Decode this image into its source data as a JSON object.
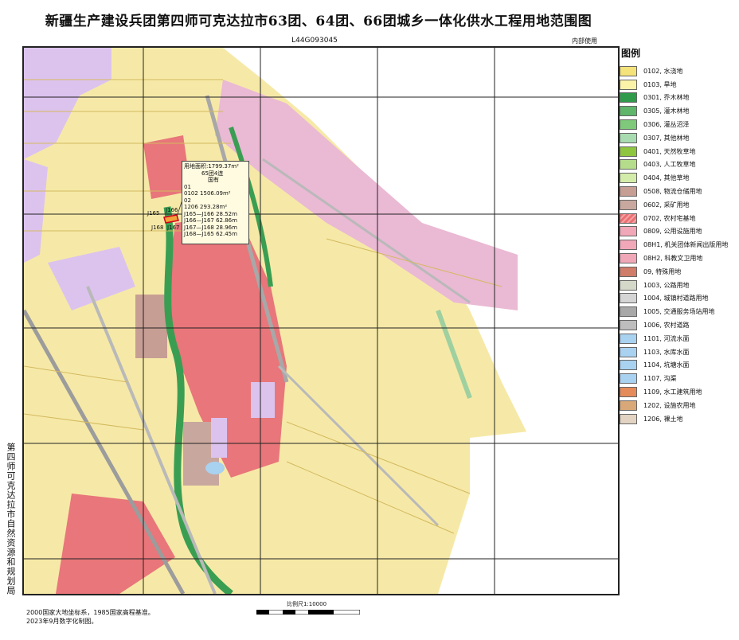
{
  "header": {
    "title": "新疆生产建设兵团第四师可克达拉市63团、64团、66团城乡一体化供水工程用地范围图",
    "sheet_number": "L44G093045",
    "secrecy": "内部使用"
  },
  "legend": {
    "title": "图例",
    "items": [
      {
        "label": "0102, 水浇地",
        "color": "#f4e27a"
      },
      {
        "label": "0103, 旱地",
        "color": "#fbf3a8"
      },
      {
        "label": "0301, 乔木林地",
        "color": "#2e9a4a"
      },
      {
        "label": "0305, 灌木林地",
        "color": "#5fb56a"
      },
      {
        "label": "0306, 灌丛沼泽",
        "color": "#7ec97a"
      },
      {
        "label": "0307, 其他林地",
        "color": "#a8dcb0"
      },
      {
        "label": "0401, 天然牧草地",
        "color": "#8fc63f"
      },
      {
        "label": "0403, 人工牧草地",
        "color": "#b5dc8a"
      },
      {
        "label": "0404, 其他草地",
        "color": "#d4ecaa"
      },
      {
        "label": "0508, 物流仓储用地",
        "color": "#c79e94"
      },
      {
        "label": "0602, 采矿用地",
        "color": "#c8a89e"
      },
      {
        "label": "0702, 农村宅基地",
        "color": "#ea6f72"
      },
      {
        "label": "0809, 公用设施用地",
        "color": "#f0a7b7"
      },
      {
        "label": "08H1, 机关团体新闻出版用地",
        "color": "#f0a7b7"
      },
      {
        "label": "08H2, 科教文卫用地",
        "color": "#f0a7b7"
      },
      {
        "label": "09, 特殊用地",
        "color": "#cf7c68"
      },
      {
        "label": "1003, 公路用地",
        "color": "#d4d8c8"
      },
      {
        "label": "1004, 城镇村道路用地",
        "color": "#d5d5d5"
      },
      {
        "label": "1005, 交通服务场站用地",
        "color": "#a8a8a8"
      },
      {
        "label": "1006, 农村道路",
        "color": "#bdbdbd"
      },
      {
        "label": "1101, 河流水面",
        "color": "#a9d1f0"
      },
      {
        "label": "1103, 水库水面",
        "color": "#a9d1f0"
      },
      {
        "label": "1104, 坑塘水面",
        "color": "#a9d1f0"
      },
      {
        "label": "1107, 沟渠",
        "color": "#a9d1f0"
      },
      {
        "label": "1109, 水工建筑用地",
        "color": "#e58b5a"
      },
      {
        "label": "1202, 设施农用地",
        "color": "#d9a878"
      },
      {
        "label": "1206, 裸土地",
        "color": "#e2d3c2"
      }
    ]
  },
  "callout": {
    "area": "用地面积:1799.37m²",
    "company": "65团4连",
    "ownership": "国有",
    "parcel1_id": "01",
    "parcel1_area": "0102 1506.09m²",
    "parcel2_id": "02",
    "parcel2_area": "1206 293.28m²",
    "segments": [
      "J165—J166   28.52m",
      "J166—J167   62.86m",
      "J167—J168   28.96m",
      "J168—J165   62.45m"
    ]
  },
  "points": {
    "j165": "J165",
    "j166": "J166",
    "j167": "J167",
    "j168": "J168"
  },
  "footer": {
    "side_org": "第四师可克达拉市自然资源和规划局",
    "note_line1": "2000国家大地坐标系，1985国家高程基准。",
    "note_line2": "2023年9月数字化制图。",
    "scale": "比例尺1:10000"
  }
}
